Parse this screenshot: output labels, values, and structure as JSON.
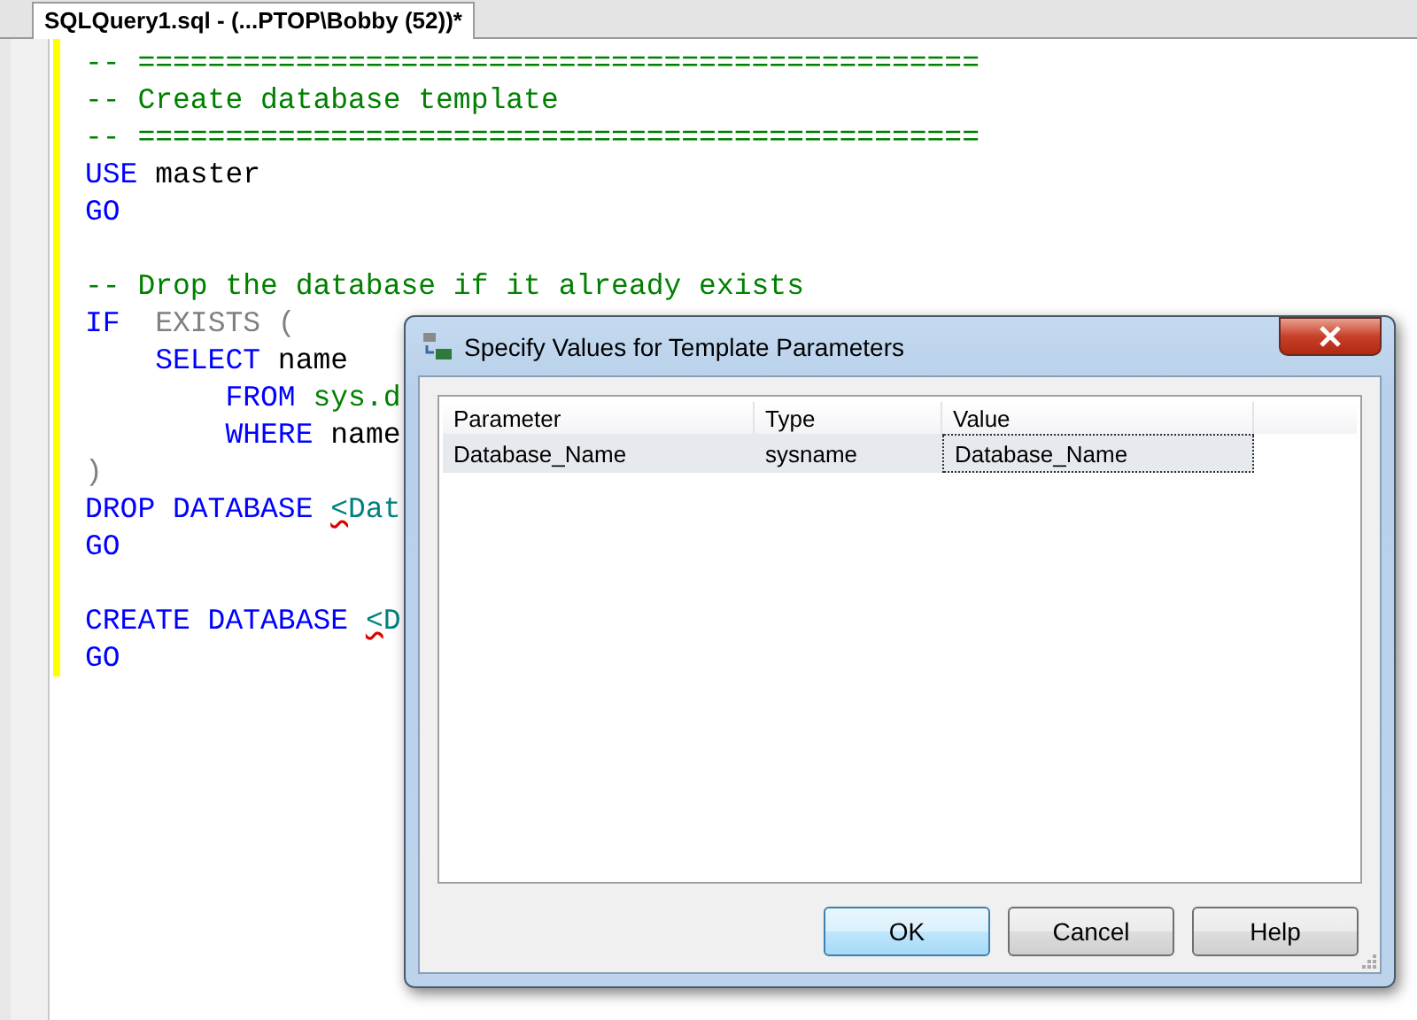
{
  "tab": {
    "title": "SQLQuery1.sql - (...PTOP\\Bobby (52))*",
    "selected": true
  },
  "editor": {
    "lines": [
      {
        "tokens": [
          {
            "kind": "comment",
            "text": "-- ================================================"
          }
        ]
      },
      {
        "tokens": [
          {
            "kind": "comment",
            "text": "-- Create database template"
          }
        ]
      },
      {
        "tokens": [
          {
            "kind": "comment",
            "text": "-- ================================================"
          }
        ]
      },
      {
        "tokens": [
          {
            "kind": "keyword",
            "text": "USE"
          },
          {
            "kind": "plain",
            "text": " master"
          }
        ]
      },
      {
        "tokens": [
          {
            "kind": "keyword",
            "text": "GO"
          }
        ]
      },
      {
        "kind": "blank"
      },
      {
        "kind": "code",
        "tokens": [
          {
            "kind": "comment",
            "text": "-- Drop the database if it already exists"
          }
        ]
      },
      {
        "tokens": [
          {
            "kind": "keyword",
            "text": "IF"
          },
          {
            "kind": "operator",
            "text": "  EXISTS ("
          }
        ]
      },
      {
        "tokens": [
          {
            "kind": "keyword",
            "text": "    SELECT"
          },
          {
            "kind": "plain",
            "text": " name"
          }
        ]
      },
      {
        "tokens": [
          {
            "kind": "keyword",
            "text": "        FROM"
          },
          {
            "kind": "object",
            "text": " sys.d"
          }
        ]
      },
      {
        "tokens": [
          {
            "kind": "keyword",
            "text": "        WHERE"
          },
          {
            "kind": "plain",
            "text": " name"
          }
        ]
      },
      {
        "tokens": [
          {
            "kind": "operator",
            "text": ")"
          }
        ]
      },
      {
        "tokens": [
          {
            "kind": "keyword",
            "text": "DROP DATABASE "
          },
          {
            "kind": "error",
            "text": "<"
          },
          {
            "kind": "param",
            "text": "Dat"
          }
        ]
      },
      {
        "tokens": [
          {
            "kind": "keyword",
            "text": "GO"
          }
        ]
      },
      {
        "kind": "blank"
      },
      {
        "kind": "code",
        "tokens": [
          {
            "kind": "keyword",
            "text": "CREATE DATABASE "
          },
          {
            "kind": "error",
            "text": "<"
          },
          {
            "kind": "param",
            "text": "D"
          }
        ]
      },
      {
        "tokens": [
          {
            "kind": "keyword",
            "text": "GO"
          }
        ]
      }
    ]
  },
  "dialog": {
    "title": "Specify Values for Template Parameters",
    "table": {
      "columns": [
        "Parameter",
        "Type",
        "Value"
      ],
      "rows": [
        {
          "selected": true,
          "cells": [
            "Database_Name",
            "sysname",
            "Database_Name"
          ]
        }
      ]
    },
    "buttons": [
      {
        "label": "OK",
        "default": true
      },
      {
        "label": "Cancel",
        "default": false
      },
      {
        "label": "Help",
        "default": false
      }
    ]
  }
}
